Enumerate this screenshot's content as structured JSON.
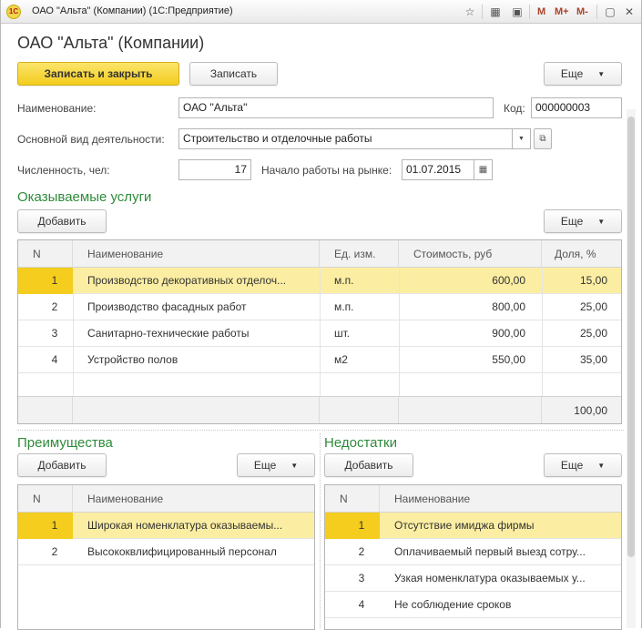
{
  "window": {
    "title": "ОАО \"Альта\" (Компании)  (1С:Предприятие)",
    "logo_text": "1С",
    "tb_m": "M",
    "tb_mplus": "M+",
    "tb_mminus": "M-"
  },
  "form": {
    "title": "ОАО \"Альта\" (Компании)",
    "save_close_label": "Записать и закрыть",
    "save_label": "Записать",
    "more_label": "Еще",
    "name_label": "Наименование:",
    "name_value": "ОАО \"Альта\"",
    "code_label": "Код:",
    "code_value": "000000003",
    "activity_label": "Основной вид деятельности:",
    "activity_value": "Строительство и отделочные работы",
    "headcount_label": "Численность, чел:",
    "headcount_value": "17",
    "market_start_label": "Начало работы на рынке:",
    "market_start_value": "01.07.2015"
  },
  "services": {
    "title": "Оказываемые услуги",
    "add_label": "Добавить",
    "more_label": "Еще",
    "columns": [
      "N",
      "Наименование",
      "Ед. изм.",
      "Стоимость, руб",
      "Доля, %"
    ],
    "rows": [
      {
        "n": "1",
        "name": "Производство декоративных отделоч...",
        "unit": "м.п.",
        "cost": "600,00",
        "share": "15,00"
      },
      {
        "n": "2",
        "name": "Производство фасадных работ",
        "unit": "м.п.",
        "cost": "800,00",
        "share": "25,00"
      },
      {
        "n": "3",
        "name": "Санитарно-технические работы",
        "unit": "шт.",
        "cost": "900,00",
        "share": "25,00"
      },
      {
        "n": "4",
        "name": "Устройство полов",
        "unit": "м2",
        "cost": "550,00",
        "share": "35,00"
      }
    ],
    "total_share": "100,00"
  },
  "advantages": {
    "title": "Преимущества",
    "add_label": "Добавить",
    "more_label": "Еще",
    "columns": [
      "N",
      "Наименование"
    ],
    "rows": [
      {
        "n": "1",
        "name": "Широкая номенклатура оказываемы..."
      },
      {
        "n": "2",
        "name": "Высококвлифицированный персонал"
      }
    ]
  },
  "disadvantages": {
    "title": "Недостатки",
    "add_label": "Добавить",
    "more_label": "Еще",
    "columns": [
      "N",
      "Наименование"
    ],
    "rows": [
      {
        "n": "1",
        "name": "Отсутствие имиджа фирмы"
      },
      {
        "n": "2",
        "name": "Оплачиваемый первый  выезд сотру..."
      },
      {
        "n": "3",
        "name": "Узкая номенклатура оказываемых у..."
      },
      {
        "n": "4",
        "name": "Не соблюдение сроков"
      }
    ]
  },
  "colors": {
    "accent_yellow": "#f4cd1e",
    "selected_row": "#fbeea3",
    "section_green": "#2e8b3a"
  }
}
